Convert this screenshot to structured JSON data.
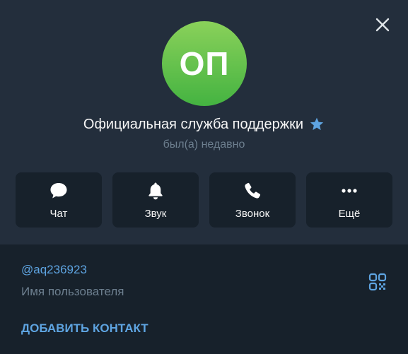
{
  "profile": {
    "avatar_initials": "ОП",
    "name": "Официальная служба поддержки",
    "status": "был(а) недавно",
    "badge_icon": "star-icon"
  },
  "actions": [
    {
      "label": "Чат",
      "icon": "chat-bubble-icon"
    },
    {
      "label": "Звук",
      "icon": "bell-icon"
    },
    {
      "label": "Звонок",
      "icon": "phone-icon"
    },
    {
      "label": "Ещё",
      "icon": "more-dots-icon"
    }
  ],
  "info": {
    "username": "@aq236923",
    "username_caption": "Имя пользователя",
    "add_contact_label": "ДОБАВИТЬ КОНТАКТ"
  },
  "colors": {
    "accent": "#5ea4e1",
    "panel_top": "#232e3c",
    "panel_bottom": "#17212b",
    "avatar_top": "#8ad15a",
    "avatar_bottom": "#44b341"
  }
}
